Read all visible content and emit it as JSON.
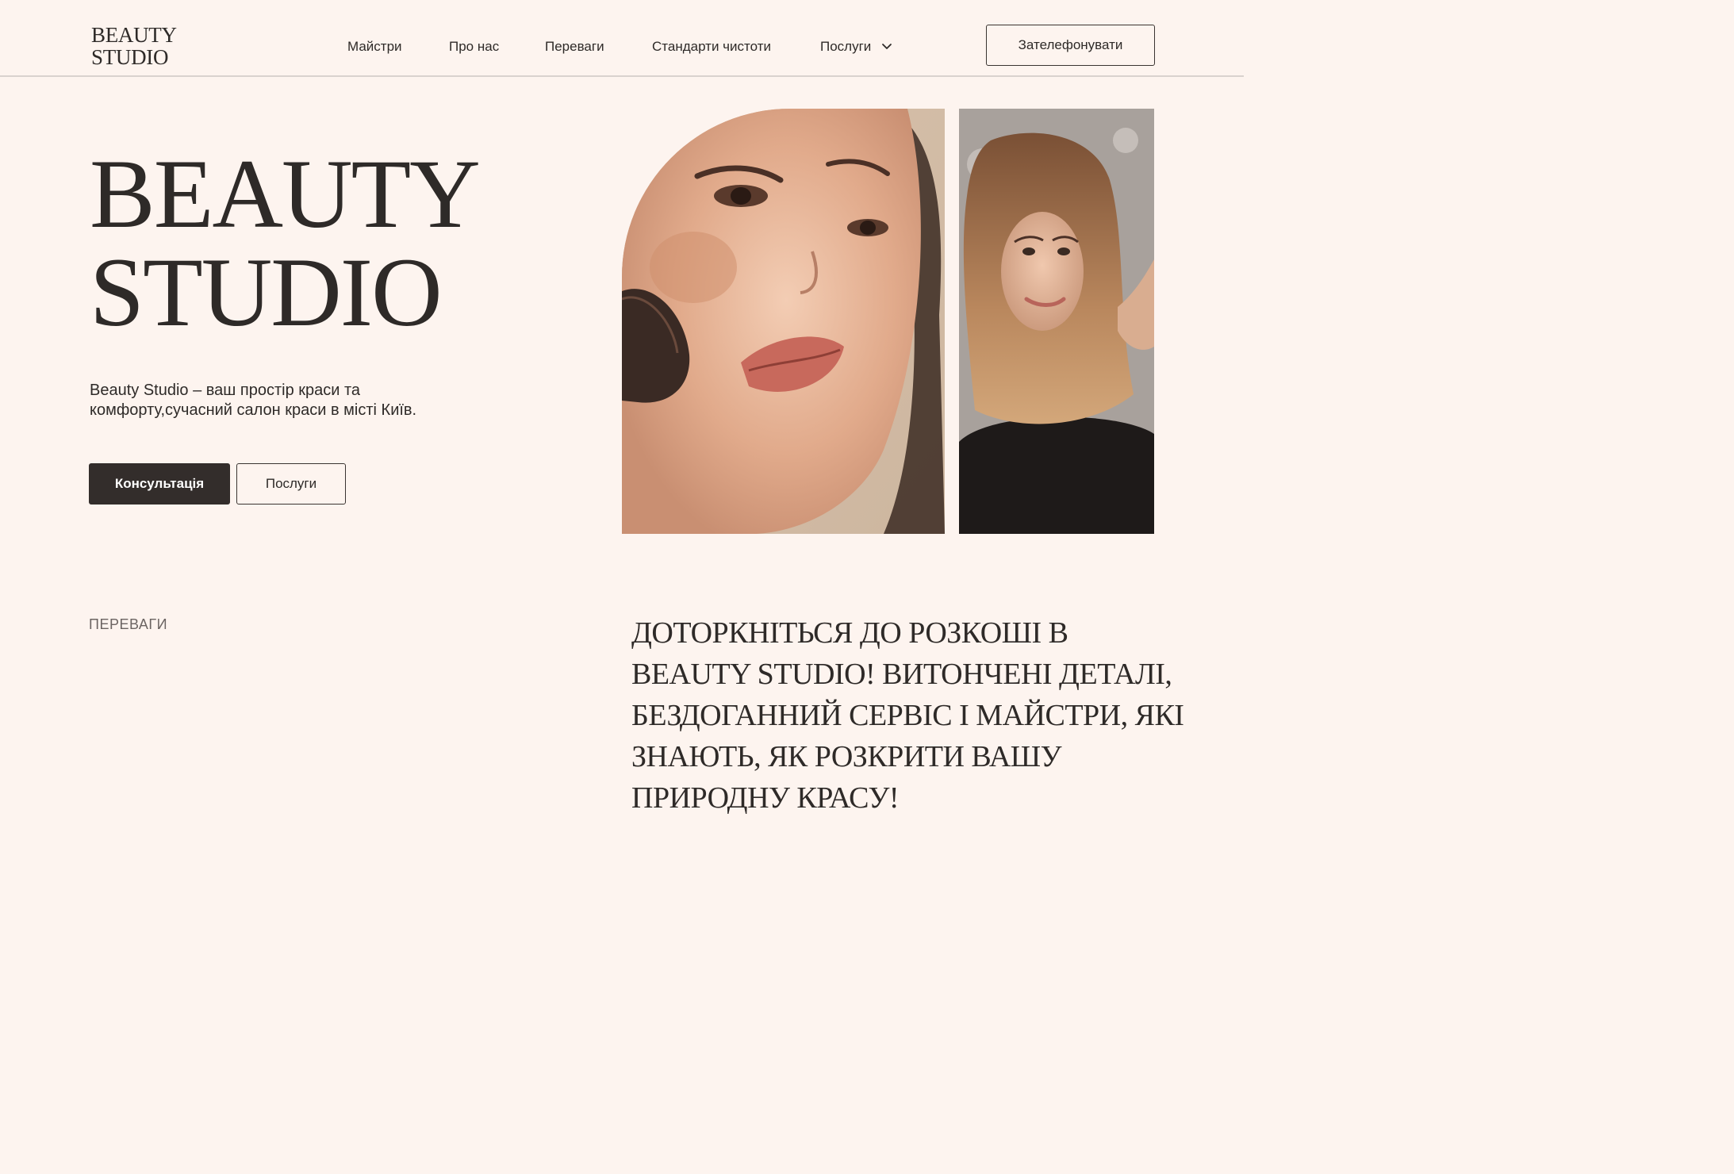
{
  "logo": {
    "line1": "BEAUTY",
    "line2": "STUDIO"
  },
  "nav": {
    "items": [
      {
        "label": "Майстри"
      },
      {
        "label": "Про нас"
      },
      {
        "label": "Переваги"
      },
      {
        "label": "Стандарти чистоти"
      },
      {
        "label": "Послуги"
      }
    ],
    "cta": "Зателефонувати"
  },
  "hero": {
    "title_line1": "BEAUTY",
    "title_line2": "STUDIO",
    "description": "Beauty Studio – ваш простір краси та комфорту,сучасний салон краси в місті Київ.",
    "primary_button": "Консультація",
    "secondary_button": "Послуги"
  },
  "benefits": {
    "label": "ПЕРЕВАГИ",
    "text": "ДОТОРКНІТЬСЯ ДО РОЗКОШІ В BEAUTY STUDIO! ВИТОНЧЕНІ ДЕТАЛІ, БЕЗДОГАННИЙ СЕРВІС І МАЙСТРИ, ЯКІ ЗНАЮТЬ, ЯК РОЗКРИТИ ВАШУ ПРИРОДНУ КРАСУ!"
  },
  "colors": {
    "background": "#fdf4ef",
    "text": "#2e2a28",
    "button_dark": "#332d2b",
    "divider": "#d9d2ce"
  },
  "icons": {
    "dropdown": "chevron-down-icon"
  }
}
